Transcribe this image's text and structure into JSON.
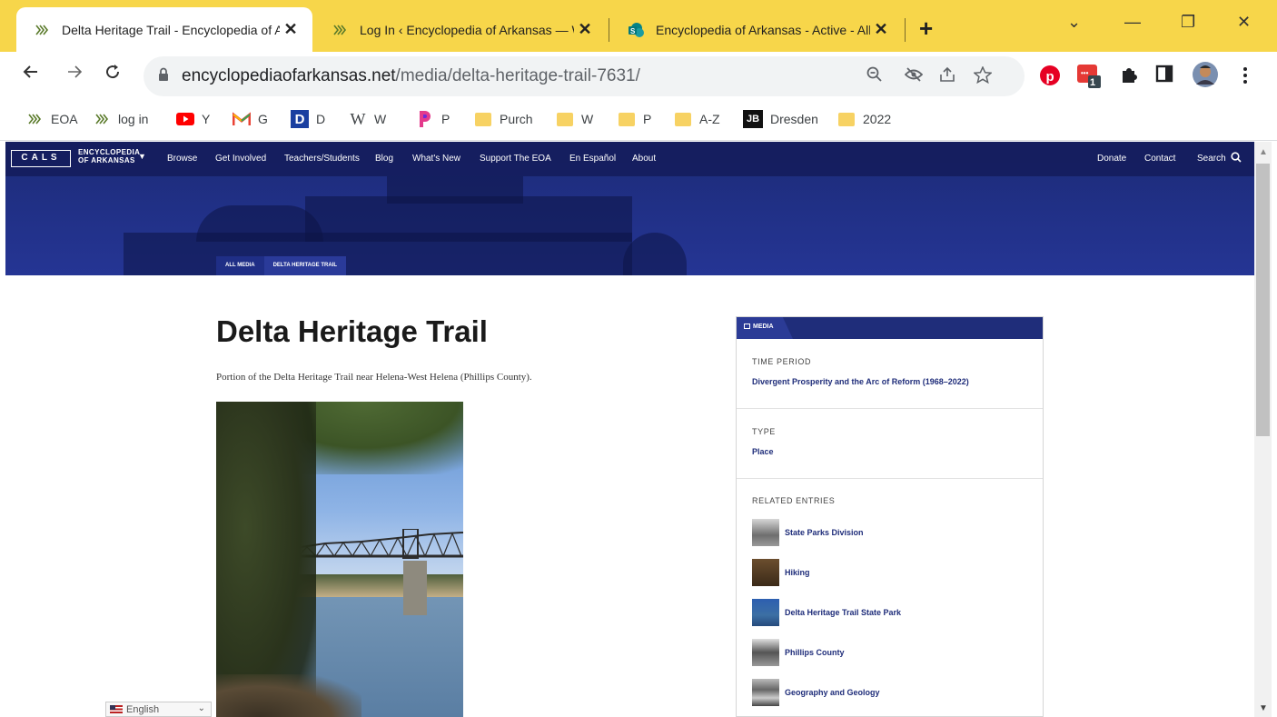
{
  "browser": {
    "tabs": [
      {
        "title": "Delta Heritage Trail - Encyclopedia of Ar",
        "favicon": "eoa-favicon",
        "active": true
      },
      {
        "title": "Log In ‹ Encyclopedia of Arkansas — W",
        "favicon": "eoa-favicon",
        "active": false
      },
      {
        "title": "Encyclopedia of Arkansas - Active - All I",
        "favicon": "sharepoint-favicon",
        "active": false
      }
    ],
    "close_glyph": "✕",
    "new_tab_glyph": "+",
    "window_controls": {
      "menu": "⌄",
      "minimize": "—",
      "restore": "❐",
      "close": "✕"
    },
    "url_domain": "encyclopediaofarkansas.net",
    "url_path": "/media/delta-heritage-trail-7631/",
    "ext_badge": "1",
    "bookmarks": [
      {
        "label": "EOA",
        "icon": "eoa-favicon"
      },
      {
        "label": "log in",
        "icon": "eoa-favicon"
      },
      {
        "label": "Y",
        "icon": "youtube-icon"
      },
      {
        "label": "G",
        "icon": "gmail-icon"
      },
      {
        "label": "D",
        "icon": "d-logo-icon"
      },
      {
        "label": "W",
        "icon": "wikipedia-icon"
      },
      {
        "label": "P",
        "icon": "p-logo-icon"
      },
      {
        "label": "Purch",
        "icon": "folder-icon"
      },
      {
        "label": "W",
        "icon": "folder-icon"
      },
      {
        "label": "P",
        "icon": "folder-icon"
      },
      {
        "label": "A-Z",
        "icon": "folder-icon"
      },
      {
        "label": "Dresden",
        "icon": "jb-logo-icon"
      },
      {
        "label": "2022",
        "icon": "folder-icon"
      }
    ]
  },
  "site": {
    "logo": "CALS",
    "brand_line1": "ENCYCLOPEDIA",
    "brand_line2": "OF ARKANSAS",
    "nav": [
      "Browse",
      "Get Involved",
      "Teachers/Students",
      "Blog",
      "What's New",
      "Support The EOA",
      "En Español",
      "About"
    ],
    "nav_right": [
      "Donate",
      "Contact",
      "Search"
    ],
    "breadcrumbs": [
      "ALL MEDIA",
      "DELTA HERITAGE TRAIL"
    ]
  },
  "page": {
    "title": "Delta Heritage Trail",
    "caption": "Portion of the Delta Heritage Trail near Helena-West Helena (Phillips County).",
    "language": "English"
  },
  "card": {
    "tab_label": "MEDIA",
    "time_period_label": "TIME PERIOD",
    "time_period_value": "Divergent Prosperity and the Arc of Reform (1968–2022)",
    "type_label": "TYPE",
    "type_value": "Place",
    "related_label": "RELATED ENTRIES",
    "related": [
      "State Parks Division",
      "Hiking",
      "Delta Heritage Trail State Park",
      "Phillips County",
      "Geography and Geology"
    ]
  },
  "colors": {
    "tabstrip": "#f7d64a",
    "site_navy": "#1f2d7a",
    "pinterest": "#e60023"
  }
}
